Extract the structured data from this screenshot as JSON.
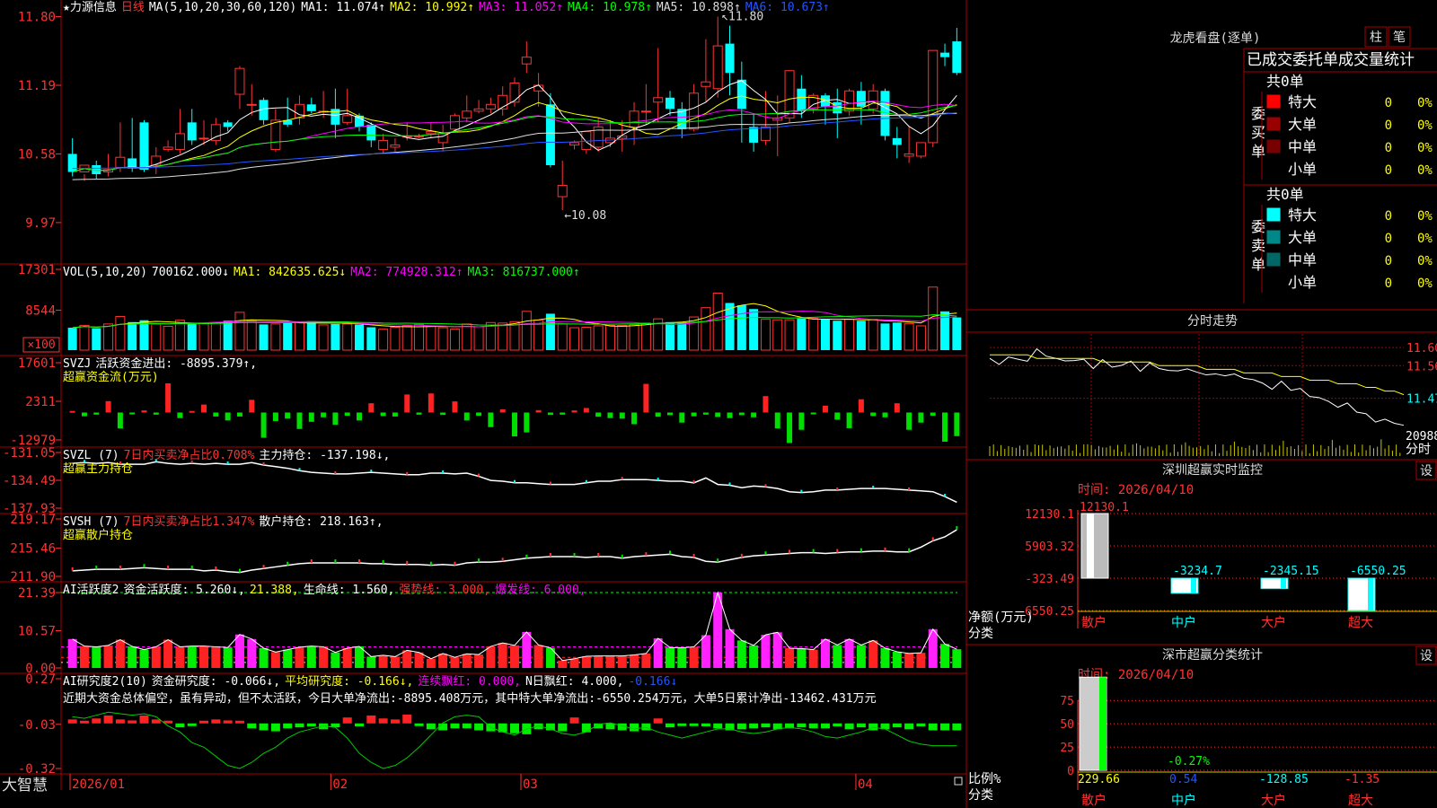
{
  "app": {
    "brand": "大智慧",
    "window_buttons": [
      "−",
      "▾"
    ]
  },
  "stock": {
    "name": "★力源信息",
    "period": "日线"
  },
  "price_panel": {
    "ma_params": "MA(5,10,20,30,60,120)",
    "indicators": [
      {
        "label": "MA1: 11.074↑",
        "color": "#ffffff"
      },
      {
        "label": "MA2: 10.992↑",
        "color": "#ffff00"
      },
      {
        "label": "MA3: 11.052↑",
        "color": "#ff00ff"
      },
      {
        "label": "MA4: 10.978↑",
        "color": "#00ff00"
      },
      {
        "label": "MA5: 10.898↑",
        "color": "#dddddd"
      },
      {
        "label": "MA6: 10.673↑",
        "color": "#2255ff"
      }
    ],
    "y_ticks": [
      "11.80",
      "11.19",
      "10.58",
      "9.97"
    ],
    "y_range": [
      9.65,
      11.9
    ],
    "high_marker": "11.80",
    "low_marker": "←10.08",
    "candles": [
      [
        10.58,
        10.72,
        10.42,
        10.38
      ],
      [
        10.42,
        10.4,
        10.48,
        10.34
      ],
      [
        10.48,
        10.52,
        10.4,
        10.36
      ],
      [
        10.42,
        10.58,
        10.44,
        10.38
      ],
      [
        10.46,
        10.86,
        10.55,
        10.42
      ],
      [
        10.54,
        10.9,
        10.45,
        10.42
      ],
      [
        10.86,
        10.88,
        10.44,
        10.42
      ],
      [
        10.48,
        10.64,
        10.56,
        10.4
      ],
      [
        10.62,
        10.7,
        10.64,
        10.6
      ],
      [
        10.62,
        10.98,
        10.76,
        10.58
      ],
      [
        10.86,
        10.98,
        10.7,
        10.66
      ],
      [
        10.72,
        10.88,
        10.72,
        10.66
      ],
      [
        10.7,
        10.9,
        10.84,
        10.66
      ],
      [
        10.86,
        10.88,
        10.82,
        10.78
      ],
      [
        11.11,
        11.36,
        11.34,
        10.98
      ],
      [
        11.02,
        11.2,
        11.02,
        10.92
      ],
      [
        11.06,
        11.08,
        10.88,
        10.84
      ],
      [
        10.62,
        10.98,
        10.88,
        10.6
      ],
      [
        10.88,
        11.08,
        10.84,
        10.82
      ],
      [
        10.9,
        11.1,
        11.02,
        10.84
      ],
      [
        11.02,
        11.08,
        10.96,
        10.94
      ],
      [
        10.96,
        11.14,
        10.96,
        10.9
      ],
      [
        10.98,
        11.16,
        10.84,
        10.72
      ],
      [
        10.86,
        11.16,
        10.92,
        10.84
      ],
      [
        10.92,
        10.94,
        10.82,
        10.78
      ],
      [
        10.84,
        10.86,
        10.7,
        10.64
      ],
      [
        10.62,
        10.76,
        10.7,
        10.58
      ],
      [
        10.64,
        10.72,
        10.66,
        10.6
      ],
      [
        10.74,
        10.86,
        10.74,
        10.7
      ],
      [
        10.74,
        10.76,
        10.74,
        10.72
      ],
      [
        10.76,
        10.86,
        10.78,
        10.72
      ],
      [
        10.68,
        10.84,
        10.76,
        10.6
      ],
      [
        10.8,
        10.94,
        10.92,
        10.78
      ],
      [
        10.9,
        11.1,
        10.96,
        10.86
      ],
      [
        10.96,
        11.06,
        10.98,
        10.94
      ],
      [
        10.98,
        11.08,
        11.02,
        10.94
      ],
      [
        10.98,
        11.18,
        11.1,
        10.92
      ],
      [
        11.04,
        11.26,
        11.21,
        11.0
      ],
      [
        11.38,
        11.58,
        11.44,
        11.3
      ],
      [
        11.14,
        11.3,
        11.19,
        11.0
      ],
      [
        11.02,
        11.12,
        10.48,
        10.46
      ],
      [
        10.2,
        10.52,
        10.3,
        10.08
      ],
      [
        10.66,
        10.7,
        10.68,
        10.62
      ],
      [
        10.62,
        10.76,
        10.78,
        10.58
      ],
      [
        10.64,
        10.9,
        10.82,
        10.6
      ],
      [
        10.68,
        10.88,
        10.72,
        10.64
      ],
      [
        10.72,
        10.88,
        10.74,
        10.6
      ],
      [
        10.82,
        11.04,
        10.96,
        10.66
      ],
      [
        10.96,
        11.2,
        10.96,
        10.84
      ],
      [
        11.04,
        11.52,
        11.08,
        10.86
      ],
      [
        11.08,
        11.14,
        10.98,
        10.92
      ],
      [
        10.98,
        11.04,
        10.8,
        10.72
      ],
      [
        10.8,
        11.2,
        11.12,
        10.78
      ],
      [
        11.18,
        11.6,
        11.22,
        11.04
      ],
      [
        11.16,
        11.8,
        11.54,
        11.08
      ],
      [
        11.56,
        11.72,
        11.3,
        11.1
      ],
      [
        11.24,
        11.4,
        10.98,
        10.68
      ],
      [
        10.82,
        10.94,
        10.68,
        10.6
      ],
      [
        10.7,
        11.14,
        10.82,
        10.66
      ],
      [
        10.88,
        11.1,
        10.9,
        10.56
      ],
      [
        10.9,
        11.22,
        11.32,
        10.86
      ],
      [
        11.16,
        11.28,
        10.96,
        10.9
      ],
      [
        10.98,
        11.12,
        11.1,
        10.94
      ],
      [
        11.1,
        11.12,
        11.0,
        10.84
      ],
      [
        11.04,
        11.16,
        10.94,
        10.72
      ],
      [
        10.96,
        11.16,
        11.14,
        10.92
      ],
      [
        11.14,
        11.22,
        11.0,
        10.84
      ],
      [
        10.98,
        11.2,
        11.14,
        10.94
      ],
      [
        11.14,
        11.16,
        10.74,
        10.7
      ],
      [
        10.72,
        10.82,
        10.66,
        10.54
      ],
      [
        10.56,
        10.82,
        10.58,
        10.5
      ],
      [
        10.56,
        10.64,
        10.68,
        10.54
      ],
      [
        10.68,
        11.48,
        11.5,
        10.64
      ],
      [
        11.48,
        11.56,
        11.44,
        11.36
      ],
      [
        11.58,
        11.7,
        11.3,
        11.28
      ]
    ]
  },
  "volume_panel": {
    "params": "VOL(5,10,20)",
    "value": "700162.000↓",
    "indicators": [
      {
        "label": "MA1: 842635.625↓",
        "color": "#ffff00"
      },
      {
        "label": "MA2: 774928.312↑",
        "color": "#ff00ff"
      },
      {
        "label": "MA3: 816737.000↑",
        "color": "#00ff00"
      }
    ],
    "y_ticks": [
      "17301",
      "8544"
    ],
    "unit": "×100",
    "volumes": [
      4.8,
      5.3,
      4.7,
      5.6,
      7.2,
      6.0,
      6.4,
      5.6,
      5.1,
      6.4,
      5.6,
      5.8,
      5.9,
      6.3,
      8.1,
      6.3,
      5.5,
      5.6,
      5.8,
      6.0,
      6.2,
      5.4,
      5.6,
      5.6,
      5.5,
      4.9,
      4.5,
      4.9,
      5.2,
      5.5,
      5.1,
      4.8,
      4.5,
      5.6,
      5.0,
      5.9,
      5.8,
      6.1,
      8.3,
      6.4,
      7.8,
      5.6,
      4.8,
      4.9,
      5.2,
      5.3,
      5.3,
      5.5,
      5.8,
      6.7,
      6.0,
      6.0,
      7.1,
      9.1,
      12.2,
      10.1,
      9.6,
      8.8,
      6.6,
      6.5,
      6.5,
      6.8,
      6.8,
      6.6,
      6.3,
      6.6,
      6.3,
      6.6,
      5.7,
      5.9,
      5.7,
      5.2,
      13.5,
      8.3,
      7.0
    ]
  },
  "svzj_panel": {
    "title": "SVZJ",
    "label": "活跃资金进出: -8895.379↑,",
    "sub_label": "超赢资金流(万元)",
    "y_ticks": [
      "17601",
      "2311",
      "-12979"
    ],
    "values": [
      600,
      -1400,
      -800,
      4300,
      -6000,
      -700,
      800,
      -800,
      11000,
      -2100,
      600,
      3000,
      -1500,
      -3000,
      -1500,
      4800,
      -9500,
      -3200,
      -2300,
      -6200,
      -3500,
      -1800,
      -4600,
      -1200,
      -3000,
      3500,
      -1300,
      -1500,
      6800,
      -800,
      7200,
      -900,
      4200,
      -3000,
      -1200,
      -5500,
      1200,
      -9000,
      -7500,
      900,
      -900,
      -800,
      800,
      1700,
      -1600,
      -2100,
      -2300,
      -4400,
      10800,
      -1600,
      -1000,
      -3800,
      -1400,
      -800,
      -1700,
      -2100,
      -1000,
      -1800,
      6200,
      -6000,
      -11500,
      -6500,
      -300,
      2600,
      -2700,
      -5900,
      5000,
      -1300,
      -1800,
      3500,
      -6500,
      -3800,
      -1200,
      -11000,
      -8900
    ]
  },
  "svzl_panel": {
    "title": "SVZL (7)",
    "label": "7日内买卖净占比0.708%",
    "label2": "主力持仓: -137.198↓,",
    "sub_label": "超赢主力持仓",
    "y_ticks": [
      "-131.05",
      "-134.49",
      "-137.93"
    ],
    "values": [
      -132.4,
      -132.3,
      -132.4,
      -132.3,
      -132.5,
      -132.5,
      -132.5,
      -132.2,
      -132.4,
      -132.5,
      -132.4,
      -132.5,
      -132.4,
      -132.5,
      -132.5,
      -132.3,
      -132.6,
      -132.8,
      -133.0,
      -133.3,
      -133.5,
      -133.6,
      -133.7,
      -133.7,
      -133.6,
      -133.5,
      -133.6,
      -133.7,
      -133.8,
      -133.8,
      -133.6,
      -133.6,
      -133.7,
      -133.6,
      -134.0,
      -134.5,
      -134.6,
      -134.8,
      -134.8,
      -134.9,
      -135.0,
      -135.0,
      -135.0,
      -134.8,
      -134.6,
      -134.6,
      -134.4,
      -134.4,
      -134.4,
      -134.5,
      -134.6,
      -134.6,
      -134.8,
      -134.2,
      -135.0,
      -135.1,
      -135.4,
      -135.2,
      -135.3,
      -135.5,
      -135.9,
      -136.0,
      -135.9,
      -135.7,
      -135.7,
      -135.6,
      -135.5,
      -135.5,
      -135.5,
      -135.6,
      -135.7,
      -135.8,
      -135.9,
      -136.5,
      -137.2
    ]
  },
  "svsh_panel": {
    "title": "SVSH (7)",
    "label": "7日内买卖净占比1.347%",
    "label2": "散户持仓: 218.163↑,",
    "sub_label": "超赢散户持仓",
    "y_ticks": [
      "219.17",
      "215.46",
      "211.90"
    ],
    "values": [
      212.6,
      212.7,
      212.8,
      212.8,
      212.8,
      212.9,
      213.0,
      212.9,
      212.8,
      212.8,
      212.8,
      212.6,
      212.7,
      212.5,
      212.4,
      212.7,
      212.9,
      213.1,
      213.3,
      213.5,
      213.6,
      213.6,
      213.6,
      213.6,
      213.6,
      213.5,
      213.5,
      213.4,
      213.4,
      213.4,
      213.3,
      213.4,
      213.3,
      213.6,
      213.7,
      213.7,
      213.8,
      214.0,
      214.2,
      214.3,
      214.4,
      214.4,
      214.4,
      214.3,
      214.4,
      214.4,
      214.2,
      214.4,
      214.5,
      214.6,
      214.7,
      214.4,
      214.3,
      213.8,
      213.7,
      214.0,
      214.3,
      214.5,
      214.6,
      214.7,
      214.8,
      214.9,
      214.9,
      214.8,
      214.9,
      215.0,
      215.0,
      215.1,
      215.1,
      215.0,
      215.0,
      215.6,
      216.4,
      216.9,
      217.8
    ]
  },
  "ai_active_panel": {
    "title": "AI活跃度2",
    "label": "资金活跃度: 5.260↓,",
    "value2": "21.388,",
    "life_line": "生命线: 1.560,",
    "strong_line": "强势线: 3.000,",
    "burst_line": "爆发线: 6.000,",
    "y_ticks": [
      "21.39",
      "10.57",
      "0.00"
    ],
    "values": [
      8.2,
      6.2,
      6.0,
      6.4,
      8.0,
      6.1,
      5.2,
      6.0,
      8.0,
      6.0,
      6.2,
      6.2,
      6.0,
      5.8,
      9.5,
      8.2,
      5.6,
      4.5,
      5.2,
      5.9,
      6.2,
      6.0,
      4.4,
      5.6,
      6.1,
      3.2,
      3.6,
      3.2,
      5.0,
      4.4,
      2.6,
      4.1,
      3.0,
      4.0,
      3.8,
      6.1,
      7.1,
      6.4,
      10.2,
      6.5,
      5.7,
      2.1,
      2.6,
      3.3,
      3.4,
      3.4,
      3.4,
      3.7,
      4.1,
      8.4,
      5.8,
      5.7,
      6.0,
      9.3,
      21.4,
      11.0,
      7.8,
      6.4,
      9.4,
      10.1,
      5.6,
      5.5,
      5.2,
      8.2,
      6.5,
      8.2,
      6.5,
      7.8,
      5.6,
      4.6,
      4.1,
      4.3,
      11.0,
      6.8,
      5.3
    ]
  },
  "ai_research_panel": {
    "title": "AI研究度2(10)",
    "label": "资金研究度: -0.066↓,",
    "avg": "平均研究度: -0.166↓,",
    "streak_red": "连续飘红: 0.000,",
    "n_days": "N日飘红: 4.000,",
    "last": "-0.166↓",
    "summary": "近期大资金总体偏空，虽有异动，但不太活跃，今日大单净流出:-8895.408万元，其中特大单净流出:-6550.254万元，大单5日累计净出-13462.431万元",
    "y_ticks": [
      "0.27",
      "-0.03",
      "-0.32"
    ],
    "values": [
      0.04,
      0.02,
      0.05,
      0.08,
      0.04,
      0.03,
      0.08,
      0.04,
      0.02,
      -0.04,
      -0.02,
      0.02,
      0.04,
      0.03,
      0.0,
      -0.05,
      -0.07,
      -0.08,
      -0.05,
      -0.04,
      -0.03,
      -0.06,
      -0.04,
      0.06,
      -0.03,
      0.08,
      0.05,
      0.04,
      0.09,
      -0.02,
      -0.06,
      -0.07,
      -0.05,
      -0.05,
      -0.07,
      -0.08,
      -0.09,
      -0.1,
      -0.11,
      -0.06,
      -0.07,
      -0.08,
      0.06,
      -0.09,
      -0.05,
      -0.06,
      -0.07,
      -0.08,
      -0.07,
      0.05,
      -0.04,
      -0.02,
      -0.01,
      -0.03,
      -0.05,
      -0.07,
      -0.06,
      -0.05,
      -0.04,
      -0.06,
      -0.05,
      -0.04,
      -0.05,
      -0.05,
      -0.03,
      -0.06,
      -0.04,
      -0.07,
      -0.06,
      -0.04,
      -0.06,
      -0.03,
      -0.07,
      -0.07,
      -0.07
    ],
    "avg_values": [
      0.02,
      0.01,
      0.03,
      0.05,
      0.04,
      0.03,
      0.04,
      0.02,
      -0.04,
      -0.08,
      -0.15,
      -0.18,
      -0.24,
      -0.3,
      -0.32,
      -0.28,
      -0.22,
      -0.18,
      -0.12,
      -0.08,
      -0.06,
      -0.04,
      -0.05,
      -0.12,
      -0.22,
      -0.28,
      -0.32,
      -0.3,
      -0.25,
      -0.18,
      -0.1,
      -0.02,
      0.02,
      0.03,
      0.02,
      -0.05,
      -0.08,
      -0.1,
      -0.06,
      -0.04,
      -0.06,
      -0.09,
      -0.1,
      -0.08,
      -0.03,
      -0.02,
      -0.04,
      -0.06,
      -0.05,
      -0.08,
      -0.1,
      -0.12,
      -0.1,
      -0.08,
      -0.06,
      -0.06,
      -0.08,
      -0.09,
      -0.08,
      -0.06,
      -0.05,
      -0.06,
      -0.08,
      -0.11,
      -0.12,
      -0.1,
      -0.08,
      -0.05,
      -0.06,
      -0.1,
      -0.14,
      -0.16,
      -0.17,
      -0.17,
      -0.17
    ]
  },
  "x_axis": {
    "labels": [
      {
        "text": "2026/01",
        "pos": 0.002
      },
      {
        "text": "02",
        "pos": 0.29
      },
      {
        "text": "03",
        "pos": 0.5
      },
      {
        "text": "04",
        "pos": 0.87
      }
    ]
  },
  "side": {
    "lhb": {
      "title": "龙虎看盘(逐单)",
      "buttons": [
        "柱",
        "笔"
      ],
      "table_header": "已成交委托单成交量统计",
      "buy": {
        "label_chars": [
          "委",
          "买",
          "单"
        ],
        "total": "共0单",
        "rows": [
          {
            "name": "特大",
            "color": "#ff0000",
            "count": "0",
            "pct": "0%"
          },
          {
            "name": "大单",
            "color": "#990000",
            "count": "0",
            "pct": "0%"
          },
          {
            "name": "中单",
            "color": "#770000",
            "count": "0",
            "pct": "0%"
          },
          {
            "name": "小单",
            "color": "#000000",
            "count": "0",
            "pct": "0%"
          }
        ]
      },
      "sell": {
        "label_chars": [
          "委",
          "卖",
          "单"
        ],
        "total": "共0单",
        "rows": [
          {
            "name": "特大",
            "color": "#00ffff",
            "count": "0",
            "pct": "0%"
          },
          {
            "name": "大单",
            "color": "#008888",
            "count": "0",
            "pct": "0%"
          },
          {
            "name": "中单",
            "color": "#006666",
            "count": "0",
            "pct": "0%"
          },
          {
            "name": "小单",
            "color": "#000000",
            "count": "0",
            "pct": "0%"
          }
        ]
      }
    },
    "intraday": {
      "title": "分时走势",
      "y_ticks": [
        {
          "text": "11.60",
          "color": "#ff3333"
        },
        {
          "text": "11.56",
          "color": "#ff3333"
        },
        {
          "text": "11.47",
          "color": "#00ffff"
        }
      ],
      "vol_tick": "20988",
      "x_label": "分时",
      "price": [
        11.57,
        11.55,
        11.58,
        11.56,
        11.57,
        11.59,
        11.58,
        11.57,
        11.56,
        11.57,
        11.56,
        11.55,
        11.56,
        11.55,
        11.55,
        11.56,
        11.54,
        11.55,
        11.55,
        11.53,
        11.54,
        11.54,
        11.53,
        11.53,
        11.52,
        11.53,
        11.52,
        11.52,
        11.51,
        11.5,
        11.49,
        11.5,
        11.49,
        11.48,
        11.47,
        11.46,
        11.45,
        11.44,
        11.44,
        11.43,
        11.41,
        11.4,
        11.4,
        11.39,
        11.39
      ],
      "avg": [
        11.58,
        11.58,
        11.58,
        11.58,
        11.58,
        11.57,
        11.57,
        11.57,
        11.57,
        11.57,
        11.57,
        11.57,
        11.56,
        11.56,
        11.56,
        11.56,
        11.56,
        11.56,
        11.55,
        11.55,
        11.55,
        11.55,
        11.55,
        11.54,
        11.54,
        11.54,
        11.54,
        11.53,
        11.53,
        11.53,
        11.53,
        11.52,
        11.52,
        11.52,
        11.51,
        11.51,
        11.51,
        11.5,
        11.5,
        11.5,
        11.49,
        11.49,
        11.48,
        11.48,
        11.47
      ],
      "y_range": [
        11.37,
        11.63
      ]
    },
    "sz_monitor": {
      "title": "深圳超赢实时监控",
      "settings": "设",
      "time": "时间: 2026/04/10",
      "ylabel": "净额(万元)",
      "xlabel": "分类",
      "y_ticks": [
        "12130.1",
        "5903.32",
        "-323.49",
        "-6550.25"
      ],
      "categories": [
        "散户",
        "中户",
        "大户",
        "超大"
      ],
      "values": [
        12130.1,
        -3234.7,
        -2345.15,
        -6550.25
      ],
      "value_labels": [
        "12130.1",
        "-3234.7",
        "-2345.15",
        "-6550.25"
      ],
      "ylim": [
        -6550.25,
        12130.1
      ]
    },
    "sz_classify": {
      "title": "深市超赢分类统计",
      "settings": "设",
      "time": "时间: 2026/04/10",
      "ylabel": "比例%",
      "xlabel": "分类",
      "y_ticks": [
        "75",
        "50",
        "25",
        "0"
      ],
      "categories": [
        "散户",
        "中户",
        "大户",
        "超大"
      ],
      "bar_value": 229.66,
      "bar_label": "-0.27%",
      "value_labels": [
        "229.66",
        "0.54",
        "-128.85",
        "-1.35"
      ],
      "label_colors": [
        "#ffff00",
        "#2255ff",
        "#00ffff",
        "#ff3333"
      ]
    }
  }
}
